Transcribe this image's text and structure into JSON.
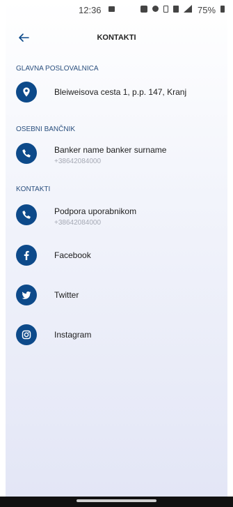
{
  "status_bar": {
    "time": "12:36",
    "battery": "75%"
  },
  "header": {
    "title": "KONTAKTI",
    "back_icon": "arrow-left-icon"
  },
  "colors": {
    "accent": "#0d4a8a",
    "section_header": "#2a4f7e",
    "subtitle": "#a5a9b4"
  },
  "sections": [
    {
      "title": "GLAVNA POSLOVALNICA",
      "items": [
        {
          "icon": "location-pin-icon",
          "title": "Bleiweisova cesta 1, p.p. 147, Kranj"
        }
      ]
    },
    {
      "title": "OSEBNI BANČNIK",
      "items": [
        {
          "icon": "phone-icon",
          "title": "Banker name banker surname",
          "subtitle": "+38642084000"
        }
      ]
    },
    {
      "title": "KONTAKTI",
      "items": [
        {
          "icon": "phone-icon",
          "title": "Podpora uporabnikom",
          "subtitle": "+38642084000"
        },
        {
          "icon": "facebook-icon",
          "title": "Facebook"
        },
        {
          "icon": "twitter-icon",
          "title": "Twitter"
        },
        {
          "icon": "instagram-icon",
          "title": "Instagram"
        }
      ]
    }
  ]
}
